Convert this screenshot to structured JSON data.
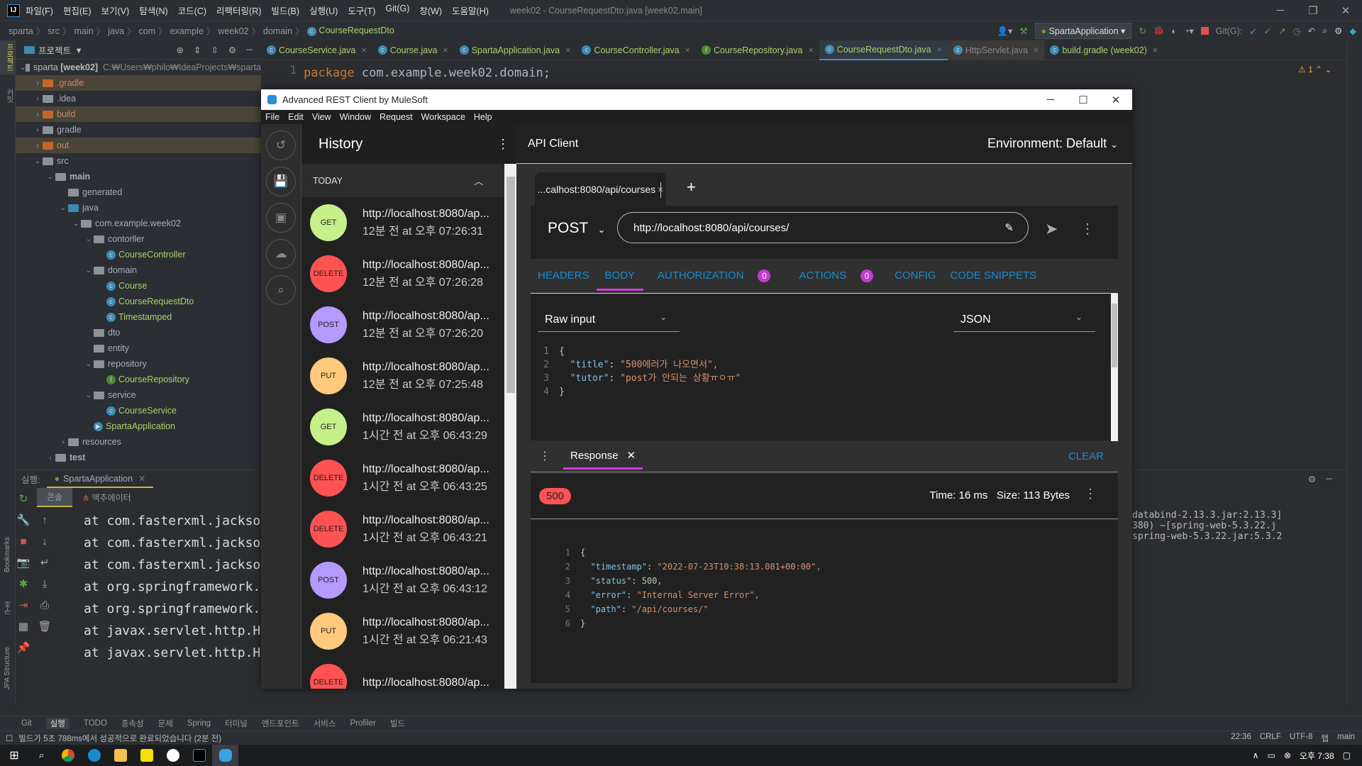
{
  "ide": {
    "menu": [
      "파일(F)",
      "편집(E)",
      "보기(V)",
      "탐색(N)",
      "코드(C)",
      "리팩터링(R)",
      "빌드(B)",
      "실행(U)",
      "도구(T)",
      "Git(G)",
      "창(W)",
      "도움말(H)"
    ],
    "window_title": "week02 - CourseRequestDto.java [week02.main]",
    "breadcrumb": [
      "sparta",
      "src",
      "main",
      "java",
      "com",
      "example",
      "week02",
      "domain",
      "CourseRequestDto"
    ],
    "run_config": "SpartaApplication",
    "git_label": "Git(G):",
    "project_label": "프로젝트",
    "project_root": "sparta",
    "project_module": "[week02]",
    "project_path": "C:₩Users₩philo₩IdeaProjects₩sparta",
    "tree": [
      {
        "label": ".gradle",
        "type": "excluded",
        "depth": 1
      },
      {
        "label": ".idea",
        "type": "folder",
        "depth": 1
      },
      {
        "label": "build",
        "type": "excluded",
        "depth": 1
      },
      {
        "label": "gradle",
        "type": "folder",
        "depth": 1
      },
      {
        "label": "out",
        "type": "excluded",
        "depth": 1
      },
      {
        "label": "src",
        "type": "folder",
        "depth": 1
      },
      {
        "label": "main",
        "type": "module",
        "depth": 2
      },
      {
        "label": "generated",
        "type": "folder",
        "depth": 3
      },
      {
        "label": "java",
        "type": "source",
        "depth": 3
      },
      {
        "label": "com.example.week02",
        "type": "package",
        "depth": 4
      },
      {
        "label": "contorller",
        "type": "package",
        "depth": 5
      },
      {
        "label": "CourseController",
        "type": "class",
        "depth": 6
      },
      {
        "label": "domain",
        "type": "package",
        "depth": 5
      },
      {
        "label": "Course",
        "type": "class",
        "depth": 6
      },
      {
        "label": "CourseRequestDto",
        "type": "class",
        "depth": 6
      },
      {
        "label": "Timestamped",
        "type": "class",
        "depth": 6
      },
      {
        "label": "dto",
        "type": "package",
        "depth": 5
      },
      {
        "label": "entity",
        "type": "package",
        "depth": 5
      },
      {
        "label": "repository",
        "type": "package",
        "depth": 5
      },
      {
        "label": "CourseRepository",
        "type": "interface",
        "depth": 6
      },
      {
        "label": "service",
        "type": "package",
        "depth": 5
      },
      {
        "label": "CourseService",
        "type": "class",
        "depth": 6
      },
      {
        "label": "SpartaApplication",
        "type": "app",
        "depth": 5
      },
      {
        "label": "resources",
        "type": "folder",
        "depth": 3
      },
      {
        "label": "test",
        "type": "module",
        "depth": 2
      }
    ],
    "editor_tabs": [
      "CourseService.java",
      "Course.java",
      "SpartaApplication.java",
      "CourseController.java",
      "CourseRepository.java",
      "CourseRequestDto.java",
      "HttpServlet.java",
      "build.gradle (week02)"
    ],
    "active_tab": "CourseRequestDto.java",
    "code_line_no": "1",
    "code_keyword": "package",
    "code_pkg": "com.example.week02.domain;",
    "warnings": "1",
    "run_label": "실행:",
    "run_tab": "SpartaApplication",
    "console_tab": "콘솔",
    "actuator_tab": "액추에이터",
    "console_lines": [
      "at com.fasterxml.jackso",
      "at com.fasterxml.jackso",
      "at com.fasterxml.jackso",
      "at org.springframework.",
      "at org.springframework.",
      "at javax.servlet.http.H",
      "at javax.servlet.http.H"
    ],
    "console_right": [
      "databind-2.13.3.jar:2.13.3]",
      "",
      "",
      "380) ~[spring-web-5.3.22.j",
      "spring-web-5.3.22.jar:5.3.2"
    ],
    "tool_windows": [
      "Git",
      "실행",
      "TODO",
      "종속성",
      "문제",
      "Spring",
      "터미널",
      "엔드포인트",
      "서비스",
      "Profiler",
      "빌드"
    ],
    "status_message": "빌드가 5초 788ms에서 성공적으로 완료되었습니다 (2분 전)",
    "status_right": [
      "22:36",
      "CRLF",
      "UTF-8",
      "탭",
      "main"
    ],
    "left_stripe": [
      "프로젝트",
      "커밋",
      "Bookmarks",
      "구조",
      "JPA Structure"
    ]
  },
  "arc": {
    "title": "Advanced REST Client by MuleSoft",
    "menu": [
      "File",
      "Edit",
      "View",
      "Window",
      "Request",
      "Workspace",
      "Help"
    ],
    "history_title": "History",
    "today": "TODAY",
    "history": [
      {
        "method": "GET",
        "url": "http://localhost:8080/ap...",
        "time": "12분 전 at 오후 07:26:31"
      },
      {
        "method": "DELETE",
        "url": "http://localhost:8080/ap...",
        "time": "12분 전 at 오후 07:26:28"
      },
      {
        "method": "POST",
        "url": "http://localhost:8080/ap...",
        "time": "12분 전 at 오후 07:26:20"
      },
      {
        "method": "PUT",
        "url": "http://localhost:8080/ap...",
        "time": "12분 전 at 오후 07:25:48"
      },
      {
        "method": "GET",
        "url": "http://localhost:8080/ap...",
        "time": "1시간 전 at 오후 06:43:29"
      },
      {
        "method": "DELETE",
        "url": "http://localhost:8080/ap...",
        "time": "1시간 전 at 오후 06:43:25"
      },
      {
        "method": "DELETE",
        "url": "http://localhost:8080/ap...",
        "time": "1시간 전 at 오후 06:43:21"
      },
      {
        "method": "POST",
        "url": "http://localhost:8080/ap...",
        "time": "1시간 전 at 오후 06:43:12"
      },
      {
        "method": "PUT",
        "url": "http://localhost:8080/ap...",
        "time": "1시간 전 at 오후 06:21:43"
      },
      {
        "method": "DELETE",
        "url": "http://localhost:8080/ap...",
        "time": ""
      }
    ],
    "method_colors": {
      "GET": "#c5f08a",
      "DELETE": "#ff5252",
      "POST": "#b39afc",
      "PUT": "#ffc97c"
    },
    "api_client": "API Client",
    "environment": "Environment: Default",
    "request_tab": "...calhost:8080/api/courses",
    "method": "POST",
    "url": "http://localhost:8080/api/courses/",
    "nav": {
      "headers": "HEADERS",
      "body": "BODY",
      "authorization": "AUTHORIZATION",
      "auth_count": "0",
      "actions": "ACTIONS",
      "actions_count": "0",
      "config": "CONFIG",
      "snippets": "CODE SNIPPETS"
    },
    "body_editor": "Raw input",
    "body_type": "JSON",
    "body_lines": [
      {
        "n": "1",
        "text": "{"
      },
      {
        "n": "2",
        "key": "\"title\"",
        "val": "\"500에러가 나오면서\","
      },
      {
        "n": "3",
        "key": "\"tutor\"",
        "val": "\"post가 안되는 상황ㅠㅇㅠ\""
      },
      {
        "n": "4",
        "text": "}"
      }
    ],
    "response_tab": "Response",
    "clear": "CLEAR",
    "status_code": "500",
    "time": "Time: 16 ms",
    "size": "Size: 113 Bytes",
    "response_lines": [
      {
        "n": "1",
        "text": "{"
      },
      {
        "n": "2",
        "key": "\"timestamp\"",
        "val": "\"2022-07-23T10:38:13.081+00:00\","
      },
      {
        "n": "3",
        "key": "\"status\"",
        "num": "500,"
      },
      {
        "n": "4",
        "key": "\"error\"",
        "val": "\"Internal Server Error\","
      },
      {
        "n": "5",
        "key": "\"path\"",
        "val": "\"/api/courses/\""
      },
      {
        "n": "6",
        "text": "}"
      }
    ]
  },
  "taskbar": {
    "clock": "오후 7:38"
  }
}
